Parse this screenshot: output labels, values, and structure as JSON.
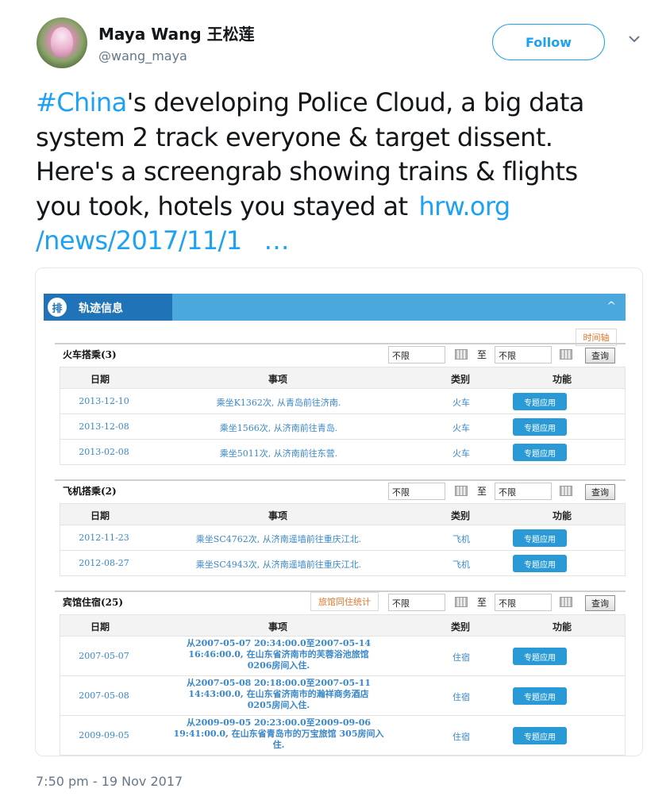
{
  "tweet": {
    "display_name": "Maya Wang 王松莲",
    "handle": "@wang_maya",
    "follow_label": "Follow",
    "caret_icon": "chevron-down-icon",
    "text": {
      "hashtag": "#China",
      "line1_rest": "'s developing Police Cloud, a big data",
      "line2": "system 2 track everyone & target dissent.",
      "line3": "Here's a screengrab showing trains & flights",
      "line4_text": "you took, hotels you stayed at",
      "link_part1": "hrw.org",
      "link_part2": "/news/2017/11/1",
      "ellipsis": "…"
    },
    "timestamp": "7:50 pm - 19 Nov 2017"
  },
  "screenshot": {
    "panel_title": "轨迹信息",
    "panel_icon_glyph": "排",
    "collapse_glyph": "^",
    "time_button": "时间轴",
    "filter_placeholder": "不限",
    "to_label": "至",
    "query_label": "查询",
    "columns": {
      "date": "日期",
      "item": "事项",
      "category": "类别",
      "function": "功能"
    },
    "function_button": "专题应用",
    "trains": {
      "title": "火车搭乘(3)",
      "rows": [
        {
          "date": "2013-12-10",
          "item": "乘坐K1362次, 从青岛前往济南.",
          "category": "火车"
        },
        {
          "date": "2013-12-08",
          "item": "乘坐1566次, 从济南前往青岛.",
          "category": "火车"
        },
        {
          "date": "2013-02-08",
          "item": "乘坐5011次, 从济南前往东营.",
          "category": "火车"
        }
      ]
    },
    "flights": {
      "title": "飞机搭乘(2)",
      "rows": [
        {
          "date": "2012-11-23",
          "item": "乘坐SC4762次, 从济南遥墙前往重庆江北.",
          "category": "飞机"
        },
        {
          "date": "2012-08-27",
          "item": "乘坐SC4943次, 从济南遥墙前往重庆江北.",
          "category": "飞机"
        }
      ]
    },
    "hotels": {
      "title": "宾馆住宿(25)",
      "stat_button": "旅馆同住统计",
      "rows": [
        {
          "date": "2007-05-07",
          "item_l1": "从2007-05-07 20:34:00.0至2007-05-14",
          "item_l2": "16:46:00.0, 在山东省济南市的芙蓉浴池旅馆",
          "item_l3": "0206房间入住.",
          "category": "住宿"
        },
        {
          "date": "2007-05-08",
          "item_l1": "从2007-05-08 20:18:00.0至2007-05-11",
          "item_l2": "14:43:00.0, 在山东省济南市的瀚祥商务酒店",
          "item_l3": "0205房间入住.",
          "category": "住宿"
        },
        {
          "date": "2009-09-05",
          "item_l1": "从2009-09-05 20:23:00.0至2009-09-06",
          "item_l2": "19:41:00.0, 在山东省青岛市的万宝旅馆 305房间入",
          "item_l3": "住.",
          "category": "住宿"
        }
      ]
    }
  }
}
